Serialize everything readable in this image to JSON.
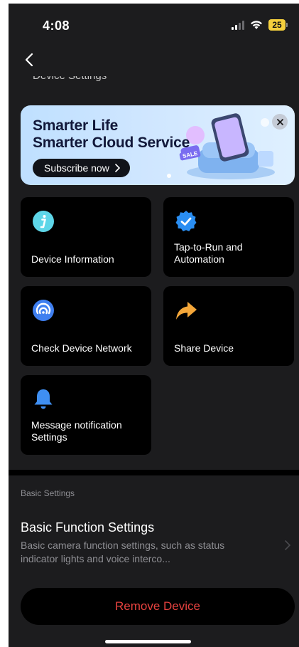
{
  "status_bar": {
    "time": "4:08",
    "battery": "25"
  },
  "header": {
    "faded_title": "Device Settings"
  },
  "banner": {
    "title_line1": "Smarter Life",
    "title_line2": "Smarter Cloud Service",
    "subscribe_label": "Subscribe now",
    "sale_tag": "SALE"
  },
  "tiles": [
    {
      "label": "Device Information",
      "icon": "info-icon"
    },
    {
      "label": "Tap-to-Run and Automation",
      "icon": "checkmark-icon"
    },
    {
      "label": "Check Device Network",
      "icon": "network-signal-icon"
    },
    {
      "label": "Share Device",
      "icon": "share-arrow-icon"
    },
    {
      "label": "Message notification Settings",
      "icon": "bell-icon"
    }
  ],
  "basic_settings": {
    "section_label": "Basic Settings",
    "title": "Basic Function Settings",
    "description": "Basic camera function settings, such as status indicator lights and voice interco..."
  },
  "remove_button": {
    "label": "Remove Device"
  },
  "colors": {
    "background": "#1c1c1e",
    "tile": "#000000",
    "danger": "#e6423f",
    "muted_text": "#8e8e93"
  }
}
